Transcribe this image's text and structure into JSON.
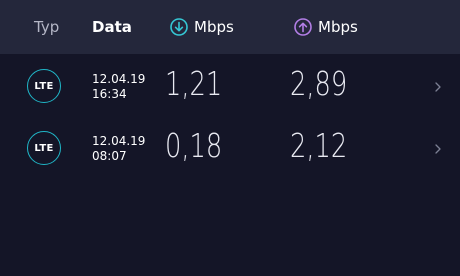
{
  "header": {
    "type_label": "Typ",
    "date_label": "Data",
    "download": {
      "icon": "download-arrow-icon",
      "label": "Mbps",
      "color": "#35c7d4"
    },
    "upload": {
      "icon": "upload-arrow-icon",
      "label": "Mbps",
      "color": "#b27ee6"
    }
  },
  "rows": [
    {
      "type": "LTE",
      "date": "12.04.19",
      "time": "16:34",
      "download": "1,21",
      "upload": "2,89"
    },
    {
      "type": "LTE",
      "date": "12.04.19",
      "time": "08:07",
      "download": "0,18",
      "upload": "2,12"
    }
  ],
  "colors": {
    "background": "#141527",
    "header_background": "#24273b",
    "badge_border": "#20b6c7"
  }
}
